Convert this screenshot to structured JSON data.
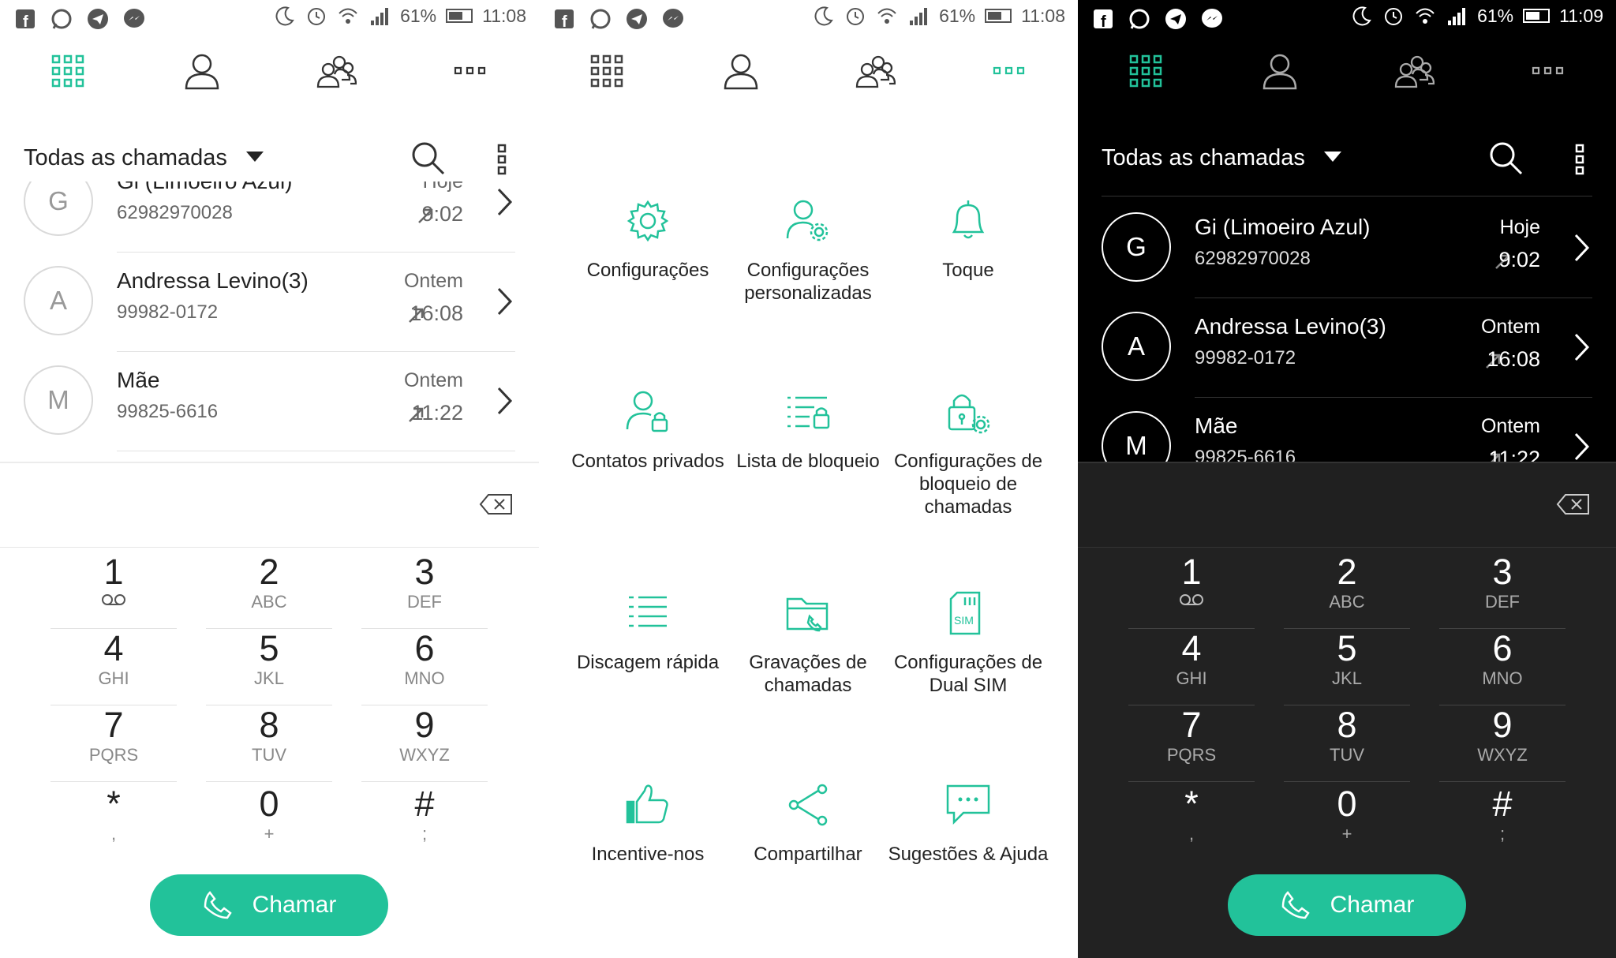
{
  "status": [
    {
      "battery": "61%",
      "time": "11:08"
    },
    {
      "battery": "61%",
      "time": "11:08"
    },
    {
      "battery": "61%",
      "time": "11:09"
    }
  ],
  "colors": {
    "accent": "#22c29a",
    "dark_bg": "#000000",
    "light_bg": "#ffffff"
  },
  "tabs": [
    {
      "name": "dialer-grid-icon"
    },
    {
      "name": "contact-icon"
    },
    {
      "name": "group-contacts-icon"
    },
    {
      "name": "more-dots-icon"
    }
  ],
  "calls": {
    "filter_label": "Todas as chamadas",
    "entries": [
      {
        "initial": "G",
        "name": "Gi (Limoeiro Azul)",
        "number": "62982970028",
        "day": "Hoje",
        "time": "9:02"
      },
      {
        "initial": "A",
        "name": "Andressa Levino(3)",
        "number": "99982-0172",
        "day": "Ontem",
        "time": "16:08"
      },
      {
        "initial": "M",
        "name": "Mãe",
        "number": "99825-6616",
        "day": "Ontem",
        "time": "11:22"
      }
    ]
  },
  "keypad": [
    {
      "digit": "1",
      "letters": ""
    },
    {
      "digit": "2",
      "letters": "ABC"
    },
    {
      "digit": "3",
      "letters": "DEF"
    },
    {
      "digit": "4",
      "letters": "GHI"
    },
    {
      "digit": "5",
      "letters": "JKL"
    },
    {
      "digit": "6",
      "letters": "MNO"
    },
    {
      "digit": "7",
      "letters": "PQRS"
    },
    {
      "digit": "8",
      "letters": "TUV"
    },
    {
      "digit": "9",
      "letters": "WXYZ"
    },
    {
      "digit": "*",
      "letters": ","
    },
    {
      "digit": "0",
      "letters": "+"
    },
    {
      "digit": "#",
      "letters": ";"
    }
  ],
  "call_button": "Chamar",
  "menu": [
    {
      "label": "Configurações",
      "icon": "gear-icon"
    },
    {
      "label": "Configurações personalizadas",
      "icon": "user-gear-icon"
    },
    {
      "label": "Toque",
      "icon": "bell-icon"
    },
    {
      "label": "Contatos privados",
      "icon": "user-lock-icon"
    },
    {
      "label": "Lista de bloqueio",
      "icon": "list-lock-icon"
    },
    {
      "label": "Configurações de bloqueio de chamadas",
      "icon": "lock-gear-icon"
    },
    {
      "label": "Discagem rápida",
      "icon": "speed-dial-icon"
    },
    {
      "label": "Gravações de chamadas",
      "icon": "folder-phone-icon"
    },
    {
      "label": "Configurações de Dual SIM",
      "icon": "sim-icon"
    },
    {
      "label": "Incentive-nos",
      "icon": "thumbs-up-icon"
    },
    {
      "label": "Compartilhar",
      "icon": "share-icon"
    },
    {
      "label": "Sugestões & Ajuda",
      "icon": "chat-icon"
    }
  ]
}
